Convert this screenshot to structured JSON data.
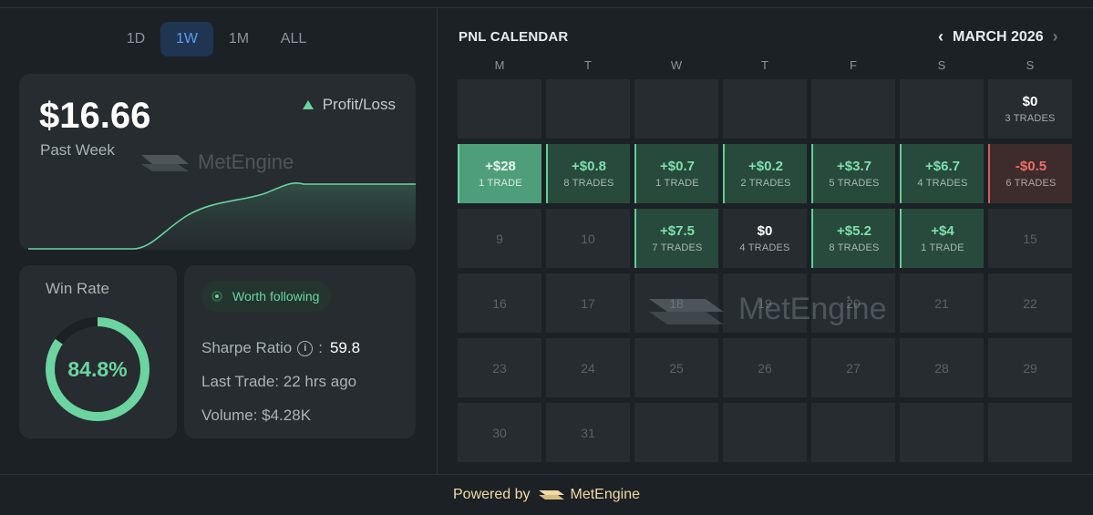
{
  "tabs": [
    {
      "label": "1D",
      "active": false
    },
    {
      "label": "1W",
      "active": true
    },
    {
      "label": "1M",
      "active": false
    },
    {
      "label": "ALL",
      "active": false
    }
  ],
  "pnl_card": {
    "value": "$16.66",
    "period": "Past Week",
    "legend": "Profit/Loss",
    "watermark": "MetEngine"
  },
  "win_rate": {
    "title": "Win Rate",
    "value_label": "84.8%",
    "fraction": 0.848
  },
  "stats": {
    "badge": "Worth following",
    "sharpe_label": "Sharpe Ratio",
    "sharpe_colon": ":",
    "sharpe_value": "59.8",
    "last_trade": "Last Trade: 22 hrs ago",
    "volume": "Volume: $4.28K"
  },
  "calendar": {
    "title": "PNL CALENDAR",
    "month": "MARCH 2026",
    "weekdays": [
      "M",
      "T",
      "W",
      "T",
      "F",
      "S",
      "S"
    ],
    "watermark": "MetEngine",
    "rows": [
      [
        null,
        null,
        null,
        null,
        null,
        null,
        {
          "amount": "$0",
          "trades": "3 TRADES",
          "kind": "zero"
        }
      ],
      [
        {
          "amount": "+$28",
          "trades": "1 TRADE",
          "kind": "big"
        },
        {
          "amount": "+$0.8",
          "trades": "8 TRADES",
          "kind": "pos"
        },
        {
          "amount": "+$0.7",
          "trades": "1 TRADE",
          "kind": "pos"
        },
        {
          "amount": "+$0.2",
          "trades": "2 TRADES",
          "kind": "pos"
        },
        {
          "amount": "+$3.7",
          "trades": "5 TRADES",
          "kind": "pos"
        },
        {
          "amount": "+$6.7",
          "trades": "4 TRADES",
          "kind": "pos"
        },
        {
          "amount": "-$0.5",
          "trades": "6 TRADES",
          "kind": "neg"
        }
      ],
      [
        {
          "day": "9"
        },
        {
          "day": "10"
        },
        {
          "amount": "+$7.5",
          "trades": "7 TRADES",
          "kind": "pos"
        },
        {
          "amount": "$0",
          "trades": "4 TRADES",
          "kind": "zero"
        },
        {
          "amount": "+$5.2",
          "trades": "8 TRADES",
          "kind": "pos"
        },
        {
          "amount": "+$4",
          "trades": "1 TRADE",
          "kind": "pos"
        },
        {
          "day": "15"
        }
      ],
      [
        {
          "day": "16"
        },
        {
          "day": "17"
        },
        {
          "day": "18"
        },
        {
          "day": "19"
        },
        {
          "day": "20"
        },
        {
          "day": "21"
        },
        {
          "day": "22"
        }
      ],
      [
        {
          "day": "23"
        },
        {
          "day": "24"
        },
        {
          "day": "25"
        },
        {
          "day": "26"
        },
        {
          "day": "27"
        },
        {
          "day": "28"
        },
        {
          "day": "29"
        }
      ],
      [
        {
          "day": "30"
        },
        {
          "day": "31"
        },
        null,
        null,
        null,
        null,
        null
      ]
    ]
  },
  "footer": {
    "powered": "Powered by",
    "brand": "MetEngine"
  },
  "colors": {
    "accent_green": "#6bd4a0",
    "loss_red": "#ef6f64",
    "active_tab": "#5b9cf0"
  }
}
